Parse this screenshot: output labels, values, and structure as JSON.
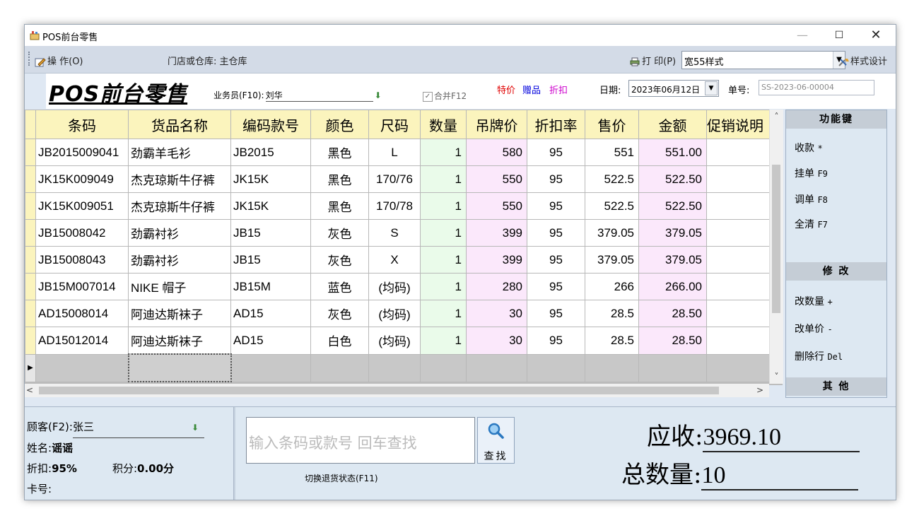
{
  "window": {
    "title": "POS前台零售"
  },
  "toolbar": {
    "operate_label": "操 作(O)",
    "store_label": "门店或仓库: 主仓库",
    "print_label": "打 印(P)",
    "print_style": "宽55样式",
    "design_label": "样式设计"
  },
  "header": {
    "big_title": "POS前台零售",
    "salesman_label": "业务员(F10):",
    "salesman_value": "刘华",
    "merge_label": "合并F12",
    "tags": {
      "special": "特价",
      "gift": "赠品",
      "discount": "折扣"
    },
    "date_label": "日期:",
    "date_value": "2023年06月12日",
    "order_label": "单号:",
    "order_value": "SS-2023-06-00004"
  },
  "grid": {
    "columns": [
      "条码",
      "货品名称",
      "编码款号",
      "颜色",
      "尺码",
      "数量",
      "吊牌价",
      "折扣率",
      "售价",
      "金额",
      "促销说明"
    ],
    "rows": [
      [
        "JB2015009041",
        "劲霸羊毛衫",
        "JB2015",
        "黑色",
        "L",
        "1",
        "580",
        "95",
        "551",
        "551.00",
        ""
      ],
      [
        "JK15K009049",
        "杰克琼斯牛仔裤",
        "JK15K",
        "黑色",
        "170/76",
        "1",
        "550",
        "95",
        "522.5",
        "522.50",
        ""
      ],
      [
        "JK15K009051",
        "杰克琼斯牛仔裤",
        "JK15K",
        "黑色",
        "170/78",
        "1",
        "550",
        "95",
        "522.5",
        "522.50",
        ""
      ],
      [
        "JB15008042",
        "劲霸衬衫",
        "JB15",
        "灰色",
        "S",
        "1",
        "399",
        "95",
        "379.05",
        "379.05",
        ""
      ],
      [
        "JB15008043",
        "劲霸衬衫",
        "JB15",
        "灰色",
        "X",
        "1",
        "399",
        "95",
        "379.05",
        "379.05",
        ""
      ],
      [
        "JB15M007014",
        "NIKE 帽子",
        "JB15M",
        "蓝色",
        "(均码)",
        "1",
        "280",
        "95",
        "266",
        "266.00",
        ""
      ],
      [
        "AD15008014",
        "阿迪达斯袜子",
        "AD15",
        "灰色",
        "(均码)",
        "1",
        "30",
        "95",
        "28.5",
        "28.50",
        ""
      ],
      [
        "AD15012014",
        "阿迪达斯袜子",
        "AD15",
        "白色",
        "(均码)",
        "1",
        "30",
        "95",
        "28.5",
        "28.50",
        ""
      ]
    ]
  },
  "fpanel": {
    "head_function": "功能键",
    "items_function": [
      {
        "label": "收款",
        "key": "*"
      },
      {
        "label": "挂单",
        "key": "F9"
      },
      {
        "label": "调单",
        "key": "F8"
      },
      {
        "label": "全清",
        "key": "F7"
      }
    ],
    "head_modify": "修  改",
    "items_modify": [
      {
        "label": "改数量",
        "key": "+"
      },
      {
        "label": "改单价",
        "key": "-"
      },
      {
        "label": "删除行",
        "key": "Del"
      }
    ],
    "head_other": "其  他"
  },
  "customer": {
    "label": "顾客(F2):",
    "value": "张三",
    "name_label": "姓名:",
    "name_value": "谣谣",
    "discount_label": "折扣:",
    "discount_value": "95%",
    "points_label": "积分:",
    "points_value": "0.00分",
    "card_label": "卡号:",
    "card_value": ""
  },
  "search": {
    "placeholder": "输入条码或款号 回车查找",
    "button_label": "查找",
    "return_hint": "切换退货状态(F11)"
  },
  "totals": {
    "due_label": "应收:",
    "due_value": "3969.10",
    "qty_label": "总数量:",
    "qty_value": "10"
  }
}
